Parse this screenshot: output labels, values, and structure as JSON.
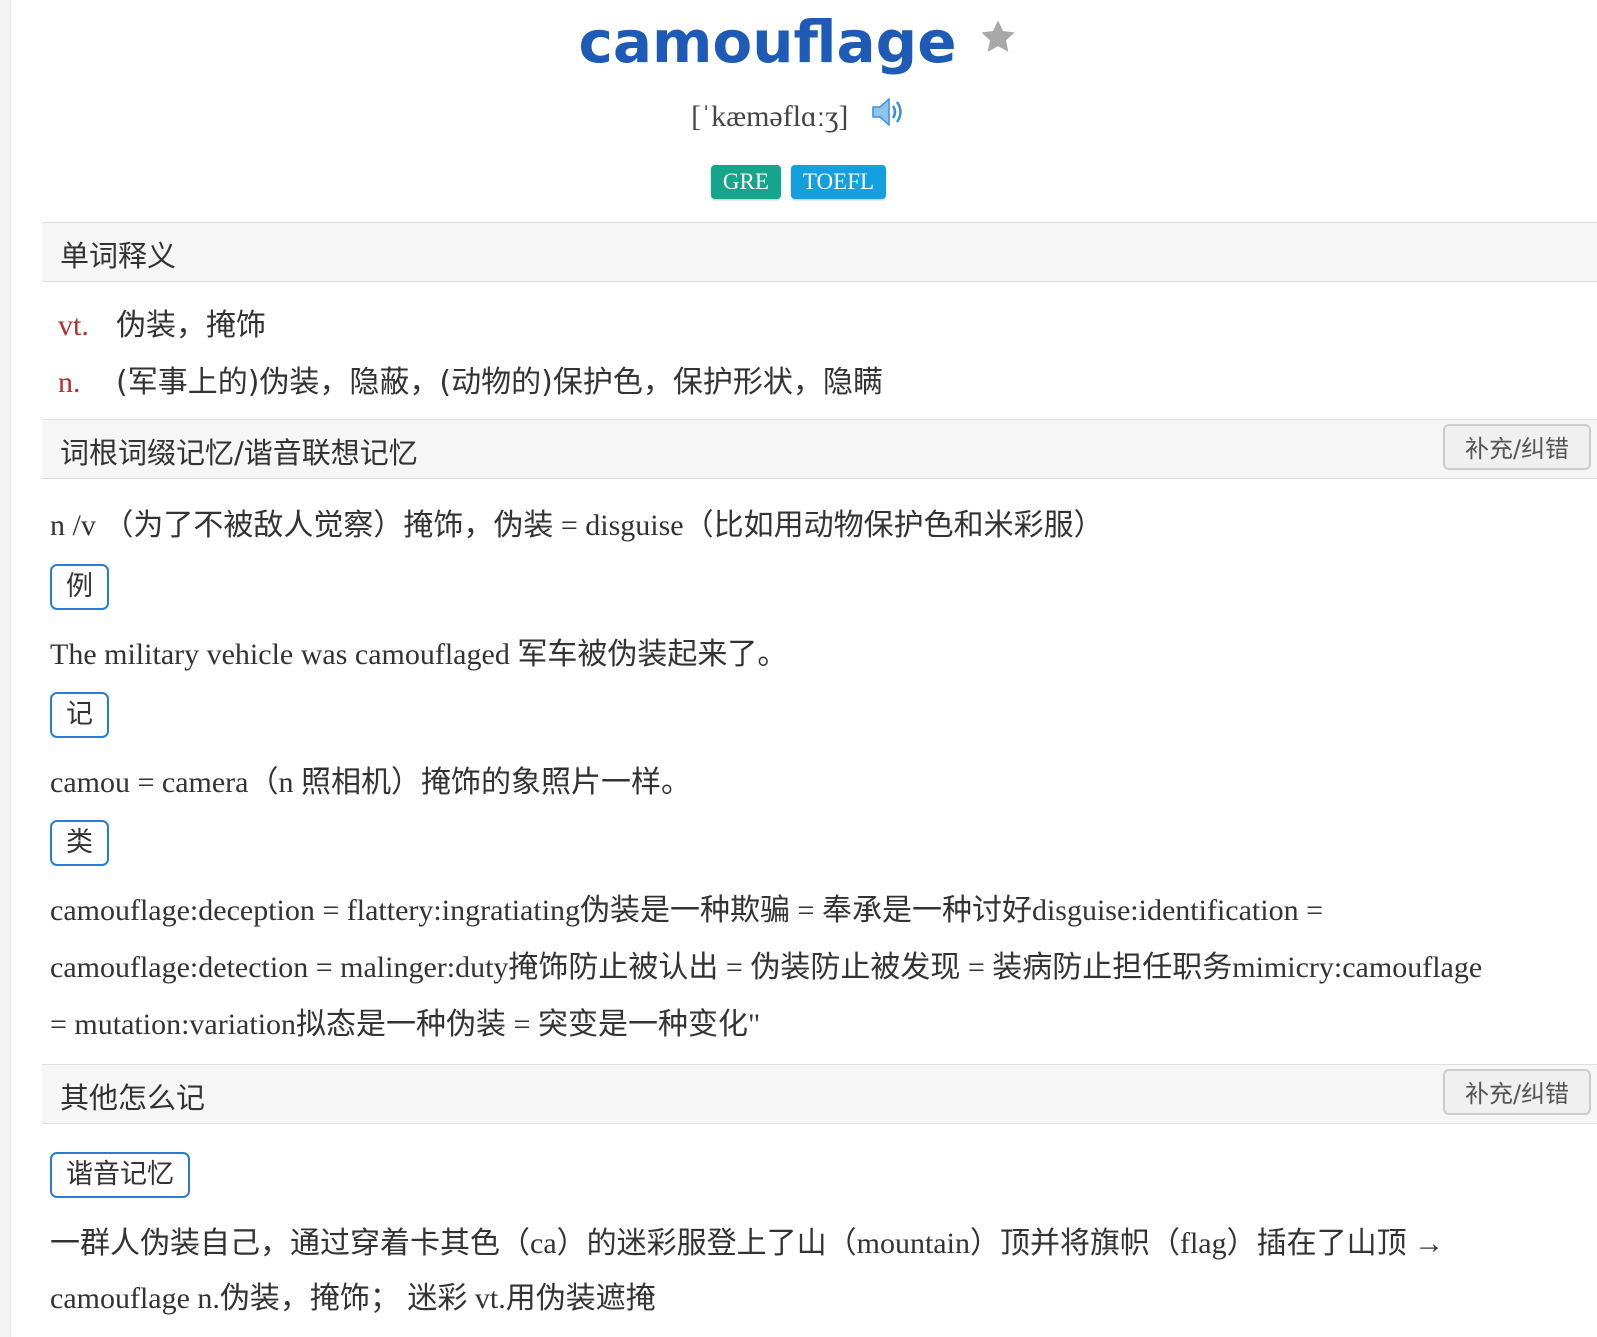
{
  "word": "camouflage",
  "phonetic": "[ˈkæməflɑːʒ]",
  "tags": [
    {
      "label": "GRE",
      "color": "#14a58c"
    },
    {
      "label": "TOEFL",
      "color": "#14a0e0"
    }
  ],
  "definitions": {
    "title": "单词释义",
    "items": [
      {
        "pos": "vt.",
        "text": "伪装，掩饰"
      },
      {
        "pos": "n.",
        "text": "(军事上的)伪装，隐蔽，(动物的)保护色，保护形状，隐瞒"
      }
    ]
  },
  "root_section": {
    "title": "词根词缀记忆/谐音联想记忆",
    "fix_label": "补充/纠错",
    "intro": "n /v （为了不被敌人觉察）掩饰，伪装 = disguise（比如用动物保护色和米彩服）",
    "example_badge": "例",
    "example": "The military vehicle was camouflaged 军车被伪装起来了。",
    "memo_badge": "记",
    "memo": "camou = camera（n 照相机）掩饰的象照片一样。",
    "analogy_badge": "类",
    "analogy_lines": [
      "camouflage:deception = flattery:ingratiating伪装是一种欺骗 = 奉承是一种讨好disguise:identification =",
      "camouflage:detection = malinger:duty掩饰防止被认出 = 伪装防止被发现 = 装病防止担任职务mimicry:camouflage",
      " = mutation:variation拟态是一种伪装 = 突变是一种变化\""
    ]
  },
  "other_section": {
    "title": "其他怎么记",
    "fix_label": "补充/纠错",
    "homophone_badge": "谐音记忆",
    "homophone_lines": [
      "一群人伪装自己，通过穿着卡其色（ca）的迷彩服登上了山（mountain）顶并将旗帜（flag）插在了山顶 →",
      "camouflage n.伪装，掩饰； 迷彩 vt.用伪装遮掩"
    ]
  },
  "colors": {
    "title_blue": "#1e5bb6",
    "pos_red": "#b03030",
    "badge_border": "#2a7bd6"
  },
  "icons": {
    "favorite": "star-icon",
    "audio": "speaker-icon"
  }
}
